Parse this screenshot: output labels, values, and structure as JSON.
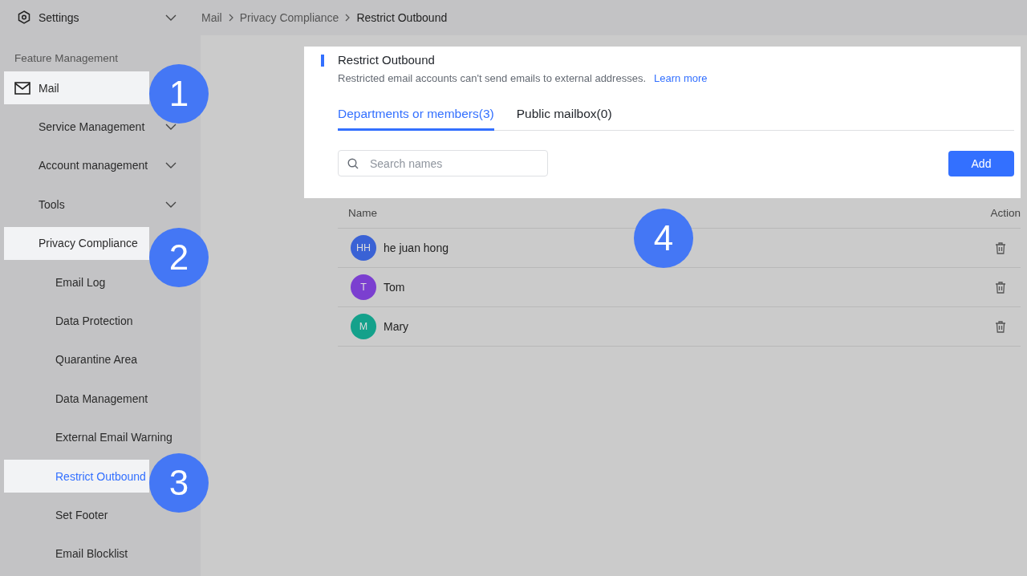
{
  "settings_menu": {
    "label": "Settings"
  },
  "breadcrumb": [
    {
      "label": "Mail",
      "current": false
    },
    {
      "label": "Privacy Compliance",
      "current": false
    },
    {
      "label": "Restrict Outbound",
      "current": true
    }
  ],
  "sidebar": {
    "section_title": "Feature Management",
    "items": [
      {
        "label": "Mail",
        "highlighted": true,
        "selected": false,
        "expandable": false,
        "children": [
          {
            "label": "Service Management",
            "highlighted": false,
            "selected": false,
            "expandable": true
          },
          {
            "label": "Account management",
            "highlighted": false,
            "selected": false,
            "expandable": true
          },
          {
            "label": "Tools",
            "highlighted": false,
            "selected": false,
            "expandable": true
          },
          {
            "label": "Privacy Compliance",
            "highlighted": true,
            "selected": false,
            "expandable": false,
            "children": [
              {
                "label": "Email Log",
                "highlighted": false,
                "selected": false
              },
              {
                "label": "Data Protection",
                "highlighted": false,
                "selected": false
              },
              {
                "label": "Quarantine Area",
                "highlighted": false,
                "selected": false
              },
              {
                "label": "Data Management",
                "highlighted": false,
                "selected": false
              },
              {
                "label": "External Email Warning",
                "highlighted": false,
                "selected": false
              },
              {
                "label": "Restrict Outbound",
                "highlighted": true,
                "selected": true
              },
              {
                "label": "Set Footer",
                "highlighted": false,
                "selected": false
              },
              {
                "label": "Email Blocklist",
                "highlighted": false,
                "selected": false
              }
            ]
          }
        ]
      }
    ]
  },
  "panel": {
    "title": "Restrict Outbound",
    "description": "Restricted email accounts can't send emails to external addresses.",
    "link": "Learn more",
    "tabs": [
      {
        "label": "Departments or members(3)",
        "selected": true
      },
      {
        "label": "Public mailbox(0)",
        "selected": false
      }
    ],
    "search": {
      "placeholder": "Search names"
    },
    "add_button": "Add"
  },
  "table": {
    "columns": [
      "Name",
      "Action"
    ],
    "rows": [
      {
        "initials": "HH",
        "name": "he juan hong",
        "color": "#3a62d5"
      },
      {
        "initials": "T",
        "name": "Tom",
        "color": "#7b3fd0"
      },
      {
        "initials": "M",
        "name": "Mary",
        "color": "#14a18b"
      }
    ]
  },
  "callouts": [
    "1",
    "2",
    "3",
    "4"
  ]
}
